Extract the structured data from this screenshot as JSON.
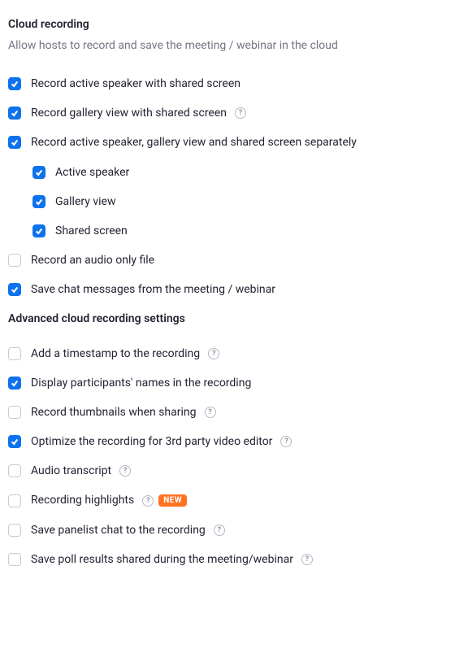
{
  "section1": {
    "title": "Cloud recording",
    "description": "Allow hosts to record and save the meeting / webinar in the cloud"
  },
  "options1": [
    {
      "label": "Record active speaker with shared screen",
      "checked": true,
      "help": false
    },
    {
      "label": "Record gallery view with shared screen",
      "checked": true,
      "help": true
    },
    {
      "label": "Record active speaker, gallery view and shared screen separately",
      "checked": true,
      "help": false
    }
  ],
  "subOptions": [
    {
      "label": "Active speaker",
      "checked": true
    },
    {
      "label": "Gallery view",
      "checked": true
    },
    {
      "label": "Shared screen",
      "checked": true
    }
  ],
  "options1b": [
    {
      "label": "Record an audio only file",
      "checked": false,
      "help": false
    },
    {
      "label": "Save chat messages from the meeting / webinar",
      "checked": true,
      "help": false
    }
  ],
  "section2": {
    "title": "Advanced cloud recording settings"
  },
  "options2": [
    {
      "label": "Add a timestamp to the recording",
      "checked": false,
      "help": true,
      "badge": null
    },
    {
      "label": "Display participants' names in the recording",
      "checked": true,
      "help": false,
      "badge": null
    },
    {
      "label": "Record thumbnails when sharing",
      "checked": false,
      "help": true,
      "badge": null
    },
    {
      "label": "Optimize the recording for 3rd party video editor",
      "checked": true,
      "help": true,
      "badge": null
    },
    {
      "label": "Audio transcript",
      "checked": false,
      "help": true,
      "badge": null
    },
    {
      "label": "Recording highlights",
      "checked": false,
      "help": true,
      "badge": "NEW"
    },
    {
      "label": "Save panelist chat to the recording",
      "checked": false,
      "help": true,
      "badge": null
    },
    {
      "label": "Save poll results shared during the meeting/webinar",
      "checked": false,
      "help": true,
      "badge": null
    }
  ],
  "badgeText": "NEW",
  "helpGlyph": "?"
}
